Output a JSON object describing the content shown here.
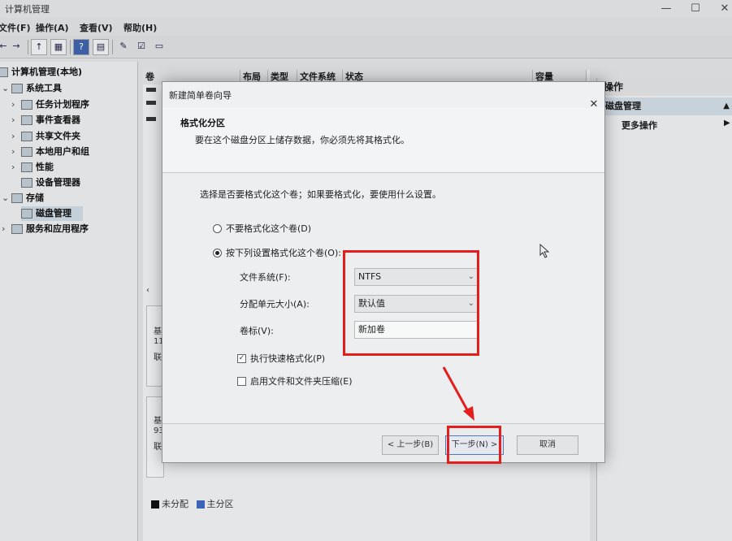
{
  "window": {
    "title": "计算机管理",
    "controls": {
      "minimize": "—",
      "maximize": "☐",
      "close": "✕"
    }
  },
  "menu": {
    "file": "文件(F)",
    "action": "操作(A)",
    "view": "查看(V)",
    "help": "帮助(H)"
  },
  "toolbar": {
    "back": "←",
    "forward": "→",
    "up": "↑",
    "show_hide": "▦",
    "help": "?",
    "properties": "▤",
    "tools": [
      "✎",
      "☑",
      "▭"
    ]
  },
  "tree": {
    "root": "计算机管理(本地)",
    "system_tools": "系统工具",
    "task_scheduler": "任务计划程序",
    "event_viewer": "事件查看器",
    "shared_folders": "共享文件夹",
    "local_users": "本地用户和组",
    "performance": "性能",
    "device_manager": "设备管理器",
    "storage": "存储",
    "disk_management": "磁盘管理",
    "services_apps": "服务和应用程序"
  },
  "volume_list": {
    "columns": [
      "卷",
      "布局",
      "类型",
      "文件系统",
      "状态",
      "容量"
    ]
  },
  "disk_panels": [
    {
      "label": "基",
      "size": "11",
      "status": "联"
    },
    {
      "label": "基",
      "size": "93",
      "status": "联"
    }
  ],
  "legend": {
    "unallocated": "未分配",
    "primary": "主分区",
    "unallocated_color": "#111111",
    "primary_color": "#3a64b8"
  },
  "actions": {
    "header": "操作",
    "section": "磁盘管理",
    "more": "更多操作"
  },
  "wizard": {
    "title": "新建简单卷向导",
    "heading": "格式化分区",
    "subheading": "要在这个磁盘分区上储存数据，你必须先将其格式化。",
    "prompt": "选择是否要格式化这个卷；如果要格式化，要使用什么设置。",
    "option_no_format": "不要格式化这个卷(D)",
    "option_format": "按下列设置格式化这个卷(O):",
    "file_system_label": "文件系统(F):",
    "file_system_value": "NTFS",
    "allocation_label": "分配单元大小(A):",
    "allocation_value": "默认值",
    "volume_label_label": "卷标(V):",
    "volume_label_value": "新加卷",
    "quick_format": "执行快速格式化(P)",
    "compression": "启用文件和文件夹压缩(E)",
    "back_button": "< 上一步(B)",
    "next_button": "下一步(N) >",
    "cancel_button": "取消"
  },
  "colors": {
    "annotation_red": "#e41d1d"
  }
}
